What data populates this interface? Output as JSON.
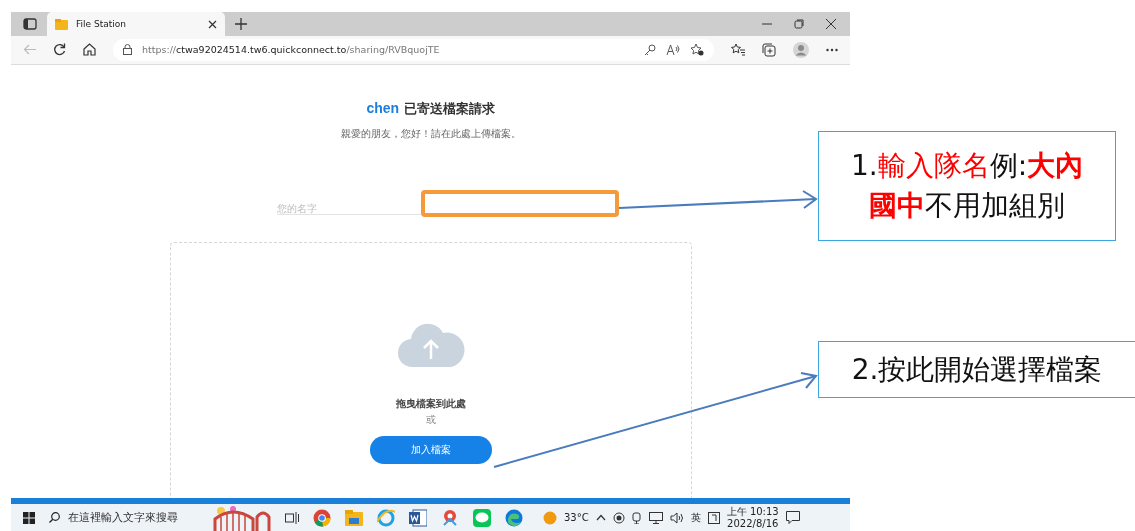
{
  "browser": {
    "tab": {
      "title": "File Station"
    },
    "address": {
      "scheme": "https://",
      "host": "ctwa92024514.tw6.quickconnect.to",
      "path": "/sharing/RVBquojTE"
    }
  },
  "page": {
    "heading": {
      "sender": "chen",
      "text": "已寄送檔案請求"
    },
    "subtitle": "親愛的朋友，您好！請在此處上傳檔案。",
    "name_field": {
      "placeholder": "您的名字"
    },
    "drop_zone": {
      "prompt": "拖曳檔案到此處",
      "or": "或",
      "button": "加入檔案"
    }
  },
  "taskbar": {
    "search": {
      "placeholder": "在這裡輸入文字來搜尋"
    },
    "weather": "33°C",
    "input_method": "英",
    "time": "上午 10:13",
    "date": "2022/8/16"
  },
  "callouts": [
    {
      "segments": [
        {
          "text": "1.",
          "kind": "plain"
        },
        {
          "text": "輸入隊名",
          "kind": "red"
        },
        {
          "text": "例:",
          "kind": "plain"
        },
        {
          "text": "大內國中",
          "kind": "red-bold"
        },
        {
          "text": "不用加組別",
          "kind": "plain"
        }
      ]
    },
    {
      "segments": [
        {
          "text": "2.按此開始選擇檔案",
          "kind": "plain"
        }
      ]
    }
  ]
}
